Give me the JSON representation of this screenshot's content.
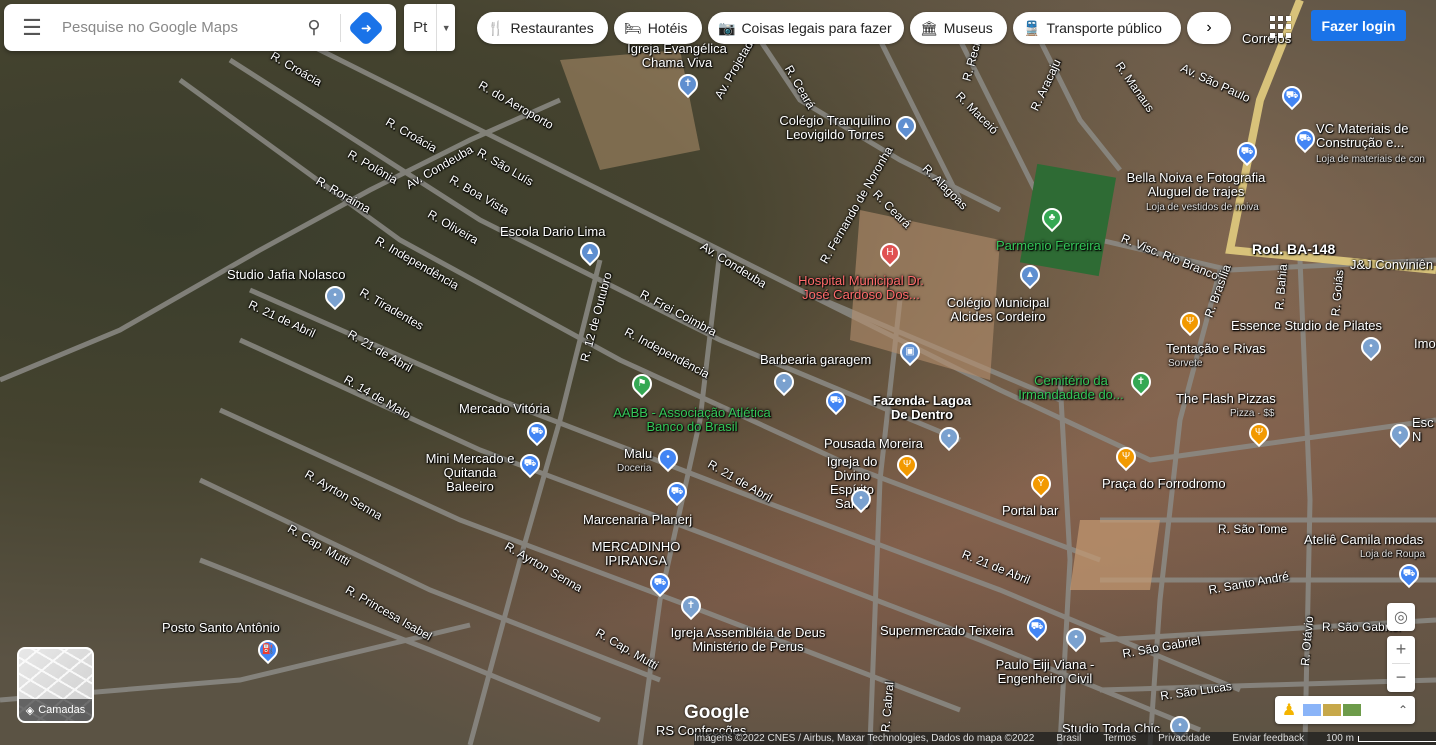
{
  "search": {
    "placeholder": "Pesquise no Google Maps",
    "menu_icon": "menu-icon",
    "search_icon": "search-icon",
    "directions_icon": "directions-icon"
  },
  "language": {
    "value": "Pt"
  },
  "chips": [
    {
      "icon": "restaurant-icon",
      "label": "Restaurantes"
    },
    {
      "icon": "hotel-icon",
      "label": "Hotéis"
    },
    {
      "icon": "camera-icon",
      "label": "Coisas legais para fazer"
    },
    {
      "icon": "museum-icon",
      "label": "Museus"
    },
    {
      "icon": "transit-icon",
      "label": "Transporte público"
    }
  ],
  "login": "Fazer login",
  "layers": "Camadas",
  "google_logo": "Google",
  "footer": {
    "imagery": "Imagens ©2022 CNES / Airbus, Maxar Technologies, Dados do mapa ©2022",
    "country": "Brasil",
    "terms": "Termos",
    "privacy": "Privacidade",
    "feedback": "Enviar feedback",
    "scale": "100 m"
  },
  "roads": [
    "R. Croácia",
    "R. do Aeroporto",
    "R. Croácia",
    "R. Polônia",
    "Av. Condeuba",
    "R. São Luís",
    "R. Roraima",
    "R. Boa Vista",
    "R. Oliveira",
    "R. Independência",
    "R. Tiradentes",
    "R. 21 de Abril",
    "R. 21 de Abril",
    "R. 14 de Maio",
    "R. 12 de Outubro",
    "R. Frei Coimbra",
    "R. Independência",
    "Av. Condeuba",
    "R. Ayrton Senna",
    "R. Cap. Mutti",
    "R. Princesa Isabel",
    "R. Ayrton Senna",
    "R. Cap. Mutti",
    "R. 21 de Abril",
    "R. 21 de Abril",
    "R. Ceará",
    "R. Ceará",
    "R. Recife",
    "R. Maceió",
    "R. Aracaju",
    "R. Manaus",
    "Av. São Paulo",
    "R. Alagoas",
    "R. Fernando de Noronha",
    "R. Visc. Rio Branco",
    "R. Brasília",
    "Rod. BA-148",
    "R. Bahia",
    "R. Goiás",
    "R. São Tome",
    "R. Santo André",
    "R. São Gabriel",
    "R. São Gabriel",
    "R. São Lucas",
    "R. Otávio",
    "R. Cabral",
    "Av. Projetada"
  ],
  "places": [
    {
      "name": "Igreja Evangélica Chama Viva",
      "icon": "church-icon"
    },
    {
      "name": "Colégio Tranquilino Leovigildo Torres",
      "icon": "school-icon"
    },
    {
      "name": "Escola Dario Lima",
      "icon": "school-icon"
    },
    {
      "name": "Studio Jafia Nolasco",
      "icon": "place-icon"
    },
    {
      "name": "Hospital Municipal Dr. José Cardoso Dos...",
      "icon": "hospital-icon"
    },
    {
      "name": "Parmenio Ferreira",
      "icon": "park-icon"
    },
    {
      "name": "Colégio Municipal Alcides Cordeiro",
      "icon": "school-icon"
    },
    {
      "name": "Barbearia garagem",
      "icon": "place-icon"
    },
    {
      "name": "Fazenda- Lagoa De Dentro",
      "icon": "place-icon"
    },
    {
      "name": "AABB - Associação Atlética Banco do Brasil",
      "icon": "sports-icon"
    },
    {
      "name": "Mercado Vitória",
      "icon": "shopping-icon"
    },
    {
      "name": "Mini Mercado e Quitanda Baleeiro",
      "icon": "shopping-icon"
    },
    {
      "name": "Malu",
      "sub": "Doceria",
      "icon": "place-icon"
    },
    {
      "name": "Pousada Moreira",
      "icon": "hotel-icon"
    },
    {
      "name": "Igreja do Divino Espírito Santo",
      "icon": "place-icon"
    },
    {
      "name": "Marcenaria Planerj",
      "icon": "place-icon"
    },
    {
      "name": "MERCADINHO IPIRANGA",
      "icon": "shopping-icon"
    },
    {
      "name": "Igreja Assembléia de Deus Ministério de Perus",
      "icon": "church-icon"
    },
    {
      "name": "Supermercado Teixeira",
      "icon": "shopping-icon"
    },
    {
      "name": "Posto Santo Antônio",
      "icon": "gas-icon"
    },
    {
      "name": "Paulo Eiji Viana - Engenheiro Civil",
      "icon": "place-icon"
    },
    {
      "name": "Portal bar",
      "icon": "bar-icon"
    },
    {
      "name": "Praça do Forrodromo",
      "icon": "restaurant-icon"
    },
    {
      "name": "Cemitério da Irmandadade do...",
      "icon": "cemetery-icon"
    },
    {
      "name": "The Flash Pizzas",
      "sub": "Pizza · $$",
      "icon": "restaurant-icon"
    },
    {
      "name": "Tentação e Rivas",
      "sub": "Sorvete",
      "icon": "restaurant-icon"
    },
    {
      "name": "Essence Studio de Pilates",
      "icon": "place-icon"
    },
    {
      "name": "Bella Noiva e Fotografia Aluguel de trajes",
      "sub": "Loja de vestidos de noiva",
      "icon": "shopping-icon"
    },
    {
      "name": "VC Materiais de Construção e...",
      "sub": "Loja de materiais de con",
      "icon": "shopping-icon"
    },
    {
      "name": "Correios",
      "icon": "place-icon"
    },
    {
      "name": "J&J Conviniên",
      "icon": "place-icon"
    },
    {
      "name": "Ateliê Camila modas",
      "sub": "Loja de Roupa",
      "icon": "shopping-icon"
    },
    {
      "name": "Studio Toda Chic",
      "icon": "place-icon"
    },
    {
      "name": "RS Confecções",
      "icon": "place-icon"
    },
    {
      "name": "Esc N",
      "icon": "place-icon"
    },
    {
      "name": "Imo",
      "icon": "place-icon"
    }
  ]
}
